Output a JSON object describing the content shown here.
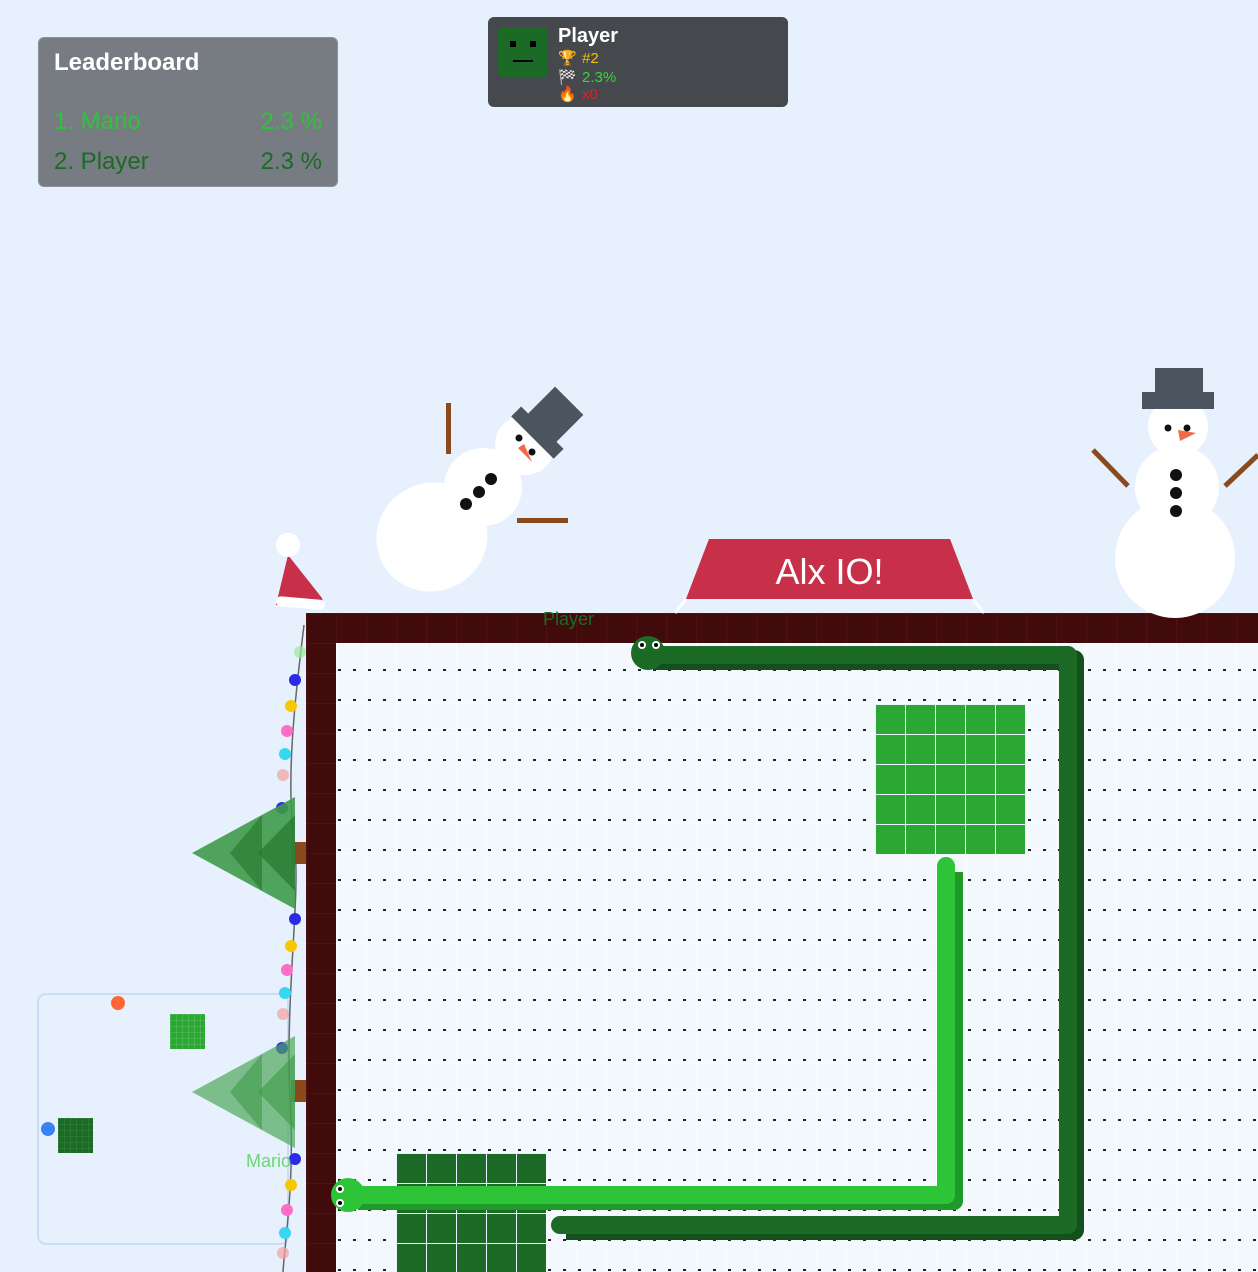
{
  "leaderboard": {
    "title": "Leaderboard",
    "entries": [
      {
        "name": "1. Mario",
        "score": "2.3 %",
        "color": "#2ec437"
      },
      {
        "name": "2. Player",
        "score": "2.3 %",
        "color": "#1b6a25"
      }
    ]
  },
  "player_card": {
    "name": "Player",
    "rank": "#2",
    "territory": "2.3%",
    "kills": "x0",
    "icons": {
      "rank": "trophy-icon",
      "territory": "checkered-flag-icon",
      "kills": "fire-icon"
    },
    "avatar_color": "#1b6a25"
  },
  "banner": {
    "text": "Alx IO!",
    "color": "#c8304a"
  },
  "players": [
    {
      "name": "Player",
      "color": "#1b6a25",
      "territory_color": "#1b6a25"
    },
    {
      "name": "Mario",
      "color": "#2ec437",
      "territory_color": "#2ec437"
    }
  ],
  "colors": {
    "background": "#e6f1fd",
    "arena_border": "#400a0a",
    "grid_dot": "#1a1a1a"
  }
}
